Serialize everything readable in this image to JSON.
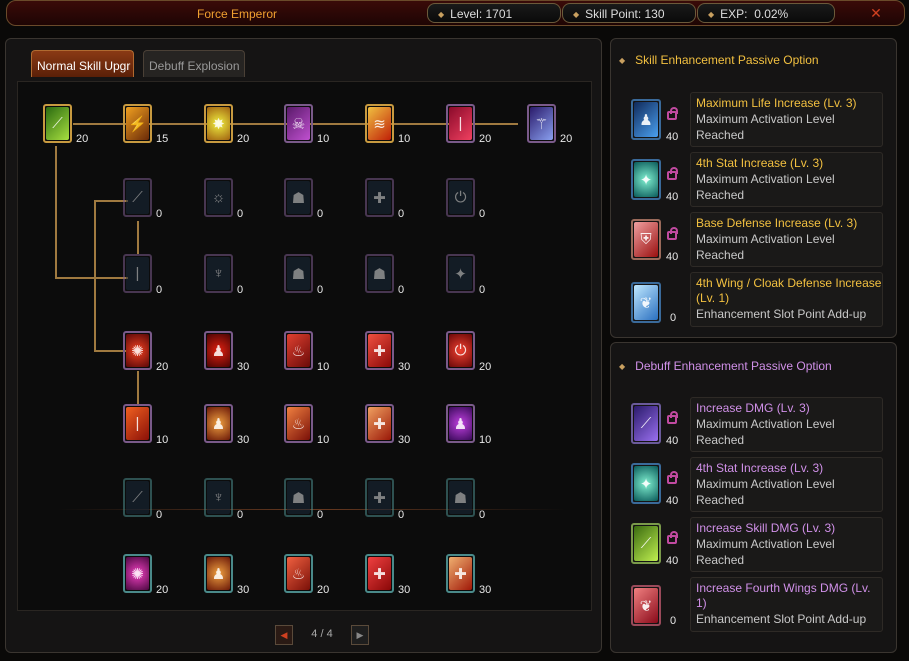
{
  "header": {
    "title": "Force Emperor",
    "level": "Level: 1701",
    "skill_point": "Skill Point: 130",
    "exp_label": "EXP:",
    "exp_value": "0.02%"
  },
  "tabs": [
    {
      "label": "Normal Skill Upgr",
      "active": true
    },
    {
      "label": "Debuff Explosion",
      "active": false
    }
  ],
  "skill_rows": [
    {
      "levels": [
        "20",
        "15",
        "20",
        "10",
        "10",
        "20",
        "20"
      ]
    },
    {
      "levels": [
        "0",
        "0",
        "0",
        "0",
        "0"
      ]
    },
    {
      "levels": [
        "0",
        "0",
        "0",
        "0",
        "0"
      ]
    },
    {
      "levels": [
        "20",
        "30",
        "10",
        "30",
        "20"
      ]
    },
    {
      "levels": [
        "10",
        "30",
        "10",
        "30",
        "10"
      ]
    },
    {
      "levels": [
        "0",
        "0",
        "0",
        "0",
        "0"
      ]
    },
    {
      "levels": [
        "20",
        "30",
        "20",
        "30",
        "30"
      ]
    }
  ],
  "pager": {
    "text": "4 / 4"
  },
  "skill_panel": {
    "heading": "Skill Enhancement Passive Option",
    "options": [
      {
        "title": "Maximum Life Increase (Lv. 3)",
        "desc": "Maximum Activation Level Reached",
        "level": "40",
        "locked": true,
        "icon": "life-icon"
      },
      {
        "title": "4th Stat Increase (Lv. 3)",
        "desc": "Maximum Activation Level Reached",
        "level": "40",
        "locked": true,
        "icon": "stat-icon"
      },
      {
        "title": "Base Defense Increase (Lv. 3)",
        "desc": "Maximum Activation Level Reached",
        "level": "40",
        "locked": true,
        "icon": "shield-icon"
      },
      {
        "title": "4th Wing / Cloak Defense Increase (Lv. 1)",
        "desc": "Enhancement Slot Point Add-up",
        "level": "0",
        "locked": false,
        "icon": "wing-icon"
      }
    ]
  },
  "debuff_panel": {
    "heading": "Debuff Enhancement Passive Option",
    "options": [
      {
        "title": "Increase DMG (Lv. 3)",
        "desc": "Maximum Activation Level Reached",
        "level": "40",
        "locked": true,
        "icon": "sword-icon"
      },
      {
        "title": "4th Stat Increase (Lv. 3)",
        "desc": "Maximum Activation Level Reached",
        "level": "40",
        "locked": true,
        "icon": "stat-icon"
      },
      {
        "title": "Increase Skill DMG (Lv. 3)",
        "desc": "Maximum Activation Level Reached",
        "level": "40",
        "locked": true,
        "icon": "skill-dmg-icon"
      },
      {
        "title": "Increase Fourth Wings DMG (Lv. 1)",
        "desc": "Enhancement Slot Point Add-up",
        "level": "0",
        "locked": false,
        "icon": "red-wing-icon"
      }
    ]
  }
}
